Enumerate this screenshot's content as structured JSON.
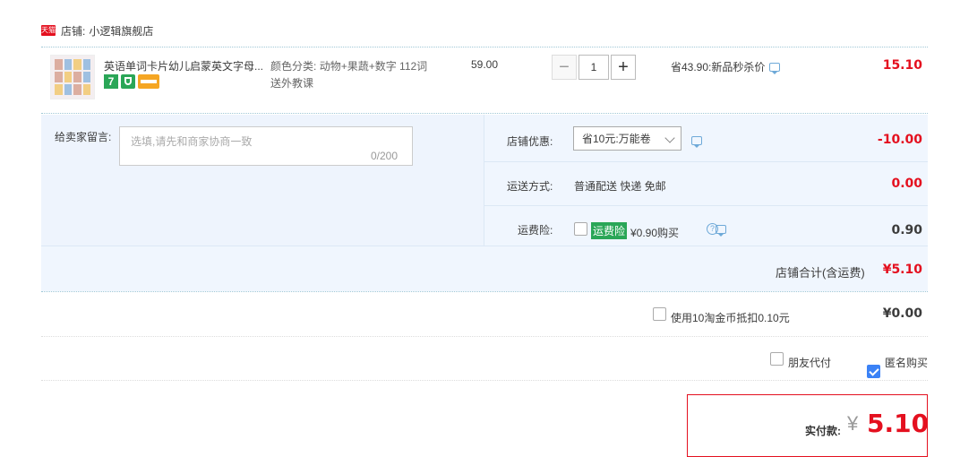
{
  "shop": {
    "badge": "天猫",
    "prefix": "店铺:",
    "name": "小逻辑旗舰店"
  },
  "item": {
    "title": "英语单词卡片幼儿启蒙英文字母...",
    "badges": {
      "seven": "7"
    },
    "sku_label": "颜色分类:",
    "sku_value": "动物+果蔬+数字 112词 送外教课",
    "price": "59.00",
    "quantity": "1",
    "qty_minus": "−",
    "qty_plus": "+",
    "promo": "省43.90:新品秒杀价",
    "subtotal": "15.10"
  },
  "note": {
    "label": "给卖家留言:",
    "placeholder": "选填,请先和商家协商一致",
    "count": "0/200"
  },
  "discount": {
    "label": "店铺优惠:",
    "selected": "省10元:万能卷",
    "value": "-10.00"
  },
  "shipping": {
    "label": "运送方式:",
    "method": "普通配送 快递 免邮",
    "value": "0.00"
  },
  "insurance": {
    "label": "运费险:",
    "tag": "运费险",
    "text": "¥0.90购买",
    "help": "?",
    "value": "0.90"
  },
  "shop_total": {
    "label": "店铺合计(含运费)",
    "value": "¥5.10"
  },
  "coins": {
    "text": "使用10淘金币抵扣0.10元",
    "value": "¥0.00"
  },
  "options": {
    "friend_pay": "朋友代付",
    "anonymous": "匿名购买"
  },
  "final": {
    "label": "实付款:",
    "yen": "¥",
    "value": "5.10"
  },
  "colors": {
    "accent": "#e4101f",
    "panel": "#f0f6fe",
    "green": "#2aa657",
    "blue": "#3b82f6"
  }
}
